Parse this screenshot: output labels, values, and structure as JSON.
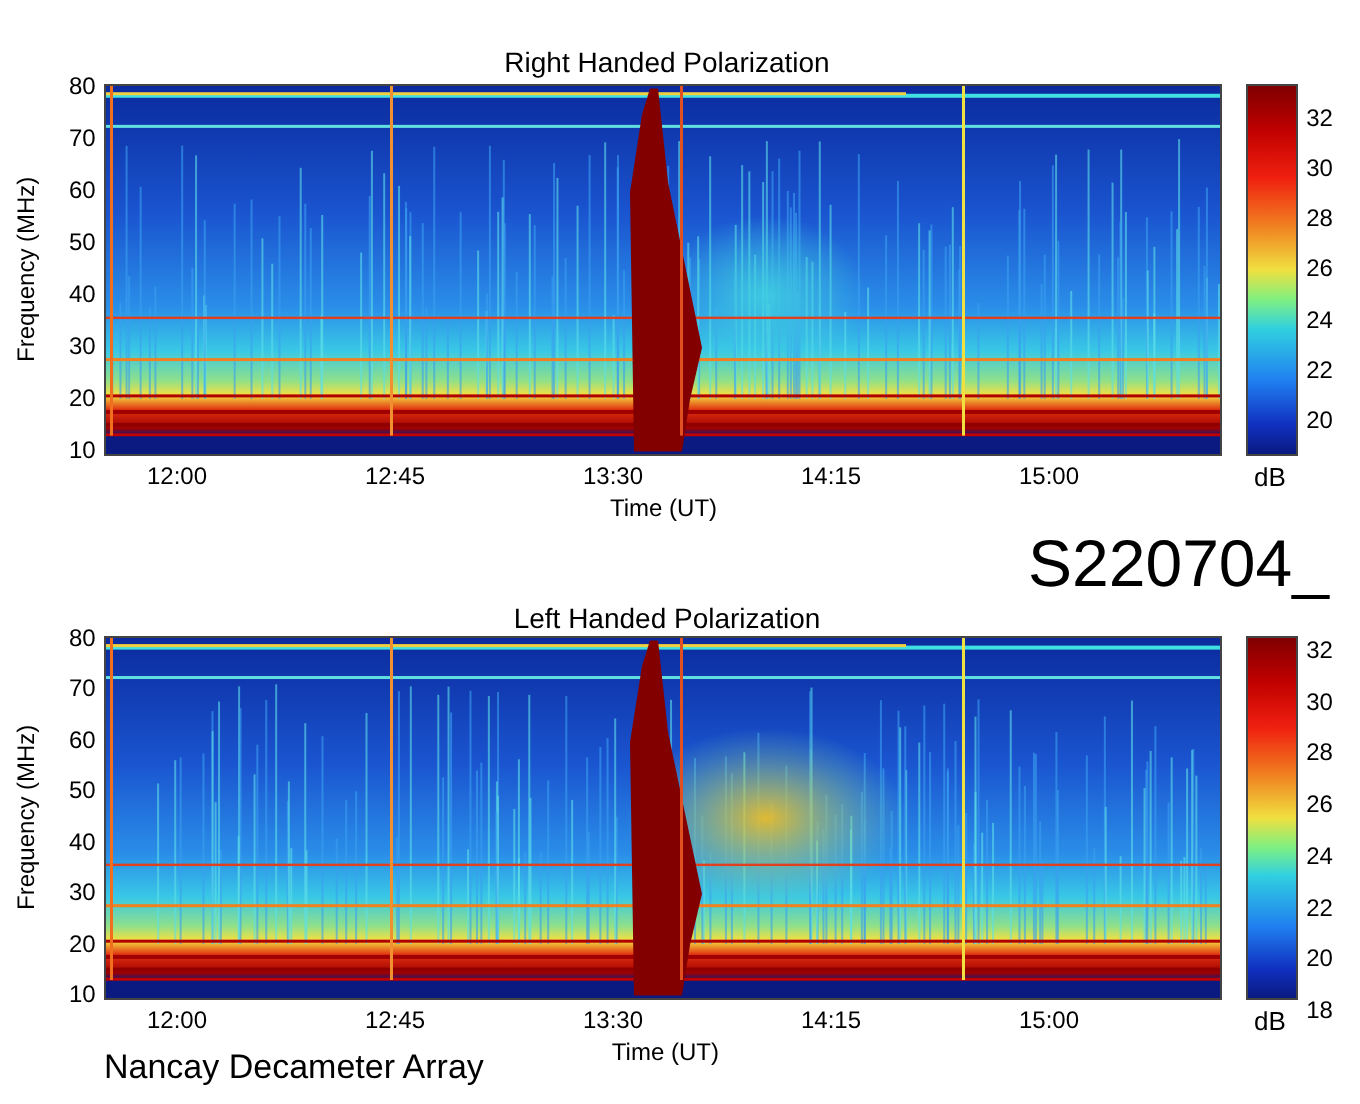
{
  "panels": [
    {
      "title": "Right Handed Polarization",
      "ylabel": "Frequency (MHz)",
      "yticks": [
        "80",
        "70",
        "60",
        "50",
        "40",
        "30",
        "20",
        "10"
      ],
      "xticks": [
        "12:00",
        "12:45",
        "13:30",
        "14:15",
        "15:00"
      ],
      "xlabel": "Time (UT)",
      "colorbar": {
        "ticks": [
          "32",
          "30",
          "28",
          "26",
          "24",
          "22",
          "20"
        ],
        "unit": "dB"
      }
    },
    {
      "title": "Left Handed Polarization",
      "ylabel": "Frequency (MHz)",
      "yticks": [
        "80",
        "70",
        "60",
        "50",
        "40",
        "30",
        "20",
        "10"
      ],
      "xticks": [
        "12:00",
        "12:45",
        "13:30",
        "14:15",
        "15:00"
      ],
      "xlabel": "Time (UT)",
      "colorbar": {
        "ticks": [
          "32",
          "30",
          "28",
          "26",
          "24",
          "22",
          "20",
          "18"
        ],
        "unit": "dB"
      }
    }
  ],
  "id_label": "S220704_",
  "footer": "Nancay Decameter Array"
}
